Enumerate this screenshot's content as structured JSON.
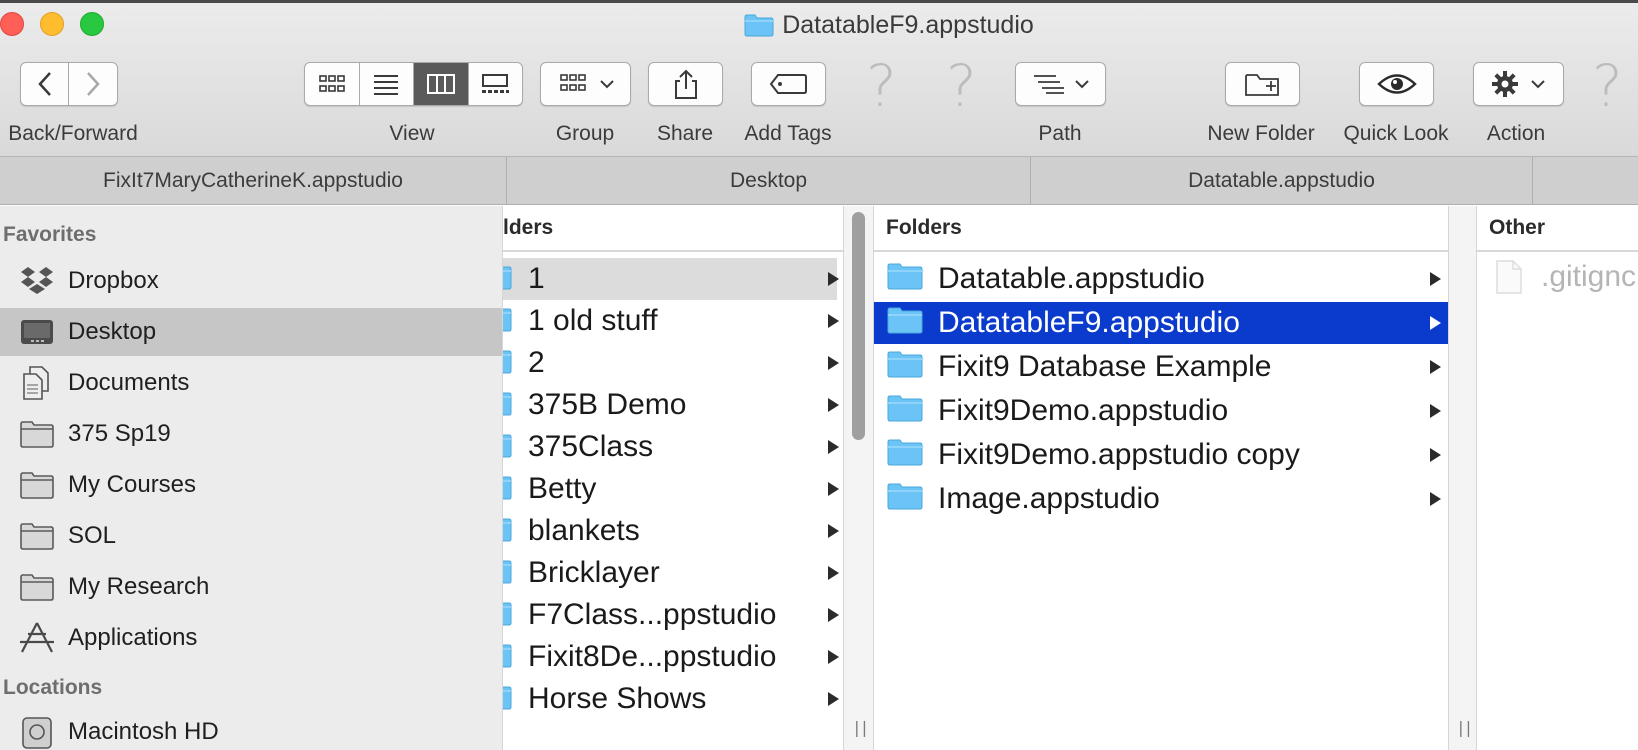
{
  "window": {
    "title": "DatatableF9.appstudio"
  },
  "toolbar": {
    "back_forward_label": "Back/Forward",
    "view_label": "View",
    "group_label": "Group",
    "share_label": "Share",
    "add_tags_label": "Add Tags",
    "path_label": "Path",
    "new_folder_label": "New Folder",
    "quick_look_label": "Quick Look",
    "action_label": "Action",
    "help_glyph": "?"
  },
  "tabs": [
    {
      "label": "FixIt7MaryCatherineK.appstudio"
    },
    {
      "label": "Desktop"
    },
    {
      "label": "Datatable.appstudio"
    }
  ],
  "sidebar": {
    "favorites_heading": "Favorites",
    "locations_heading": "Locations",
    "items": [
      {
        "label": "Dropbox",
        "icon": "dropbox-icon"
      },
      {
        "label": "Desktop",
        "icon": "desktop-icon",
        "selected": true
      },
      {
        "label": "Documents",
        "icon": "documents-icon"
      },
      {
        "label": "375 Sp19",
        "icon": "folder-icon"
      },
      {
        "label": "My Courses",
        "icon": "folder-icon"
      },
      {
        "label": "SOL",
        "icon": "folder-icon"
      },
      {
        "label": "My Research",
        "icon": "folder-icon"
      },
      {
        "label": "Applications",
        "icon": "applications-icon"
      }
    ],
    "location_items": [
      {
        "label": "Macintosh HD",
        "icon": "disk-icon"
      }
    ]
  },
  "column1": {
    "heading": "lders",
    "items": [
      {
        "label": "1",
        "selected": true
      },
      {
        "label": "1 old stuff"
      },
      {
        "label": "2"
      },
      {
        "label": "375B Demo"
      },
      {
        "label": "375Class"
      },
      {
        "label": "Betty"
      },
      {
        "label": "blankets"
      },
      {
        "label": "Bricklayer"
      },
      {
        "label": "F7Class...ppstudio"
      },
      {
        "label": "Fixit8De...ppstudio"
      },
      {
        "label": "Horse Shows"
      }
    ]
  },
  "column2": {
    "heading": "Folders",
    "items": [
      {
        "label": "Datatable.appstudio"
      },
      {
        "label": "DatatableF9.appstudio",
        "selected": true
      },
      {
        "label": "Fixit9 Database Example"
      },
      {
        "label": "Fixit9Demo.appstudio"
      },
      {
        "label": "Fixit9Demo.appstudio copy"
      },
      {
        "label": "Image.appstudio"
      }
    ]
  },
  "column3": {
    "heading": "Other",
    "items": [
      {
        "label": ".gitignc"
      }
    ]
  },
  "colors": {
    "selection_blue": "#0a3bcc",
    "folder_blue": "#6cc3f5"
  }
}
